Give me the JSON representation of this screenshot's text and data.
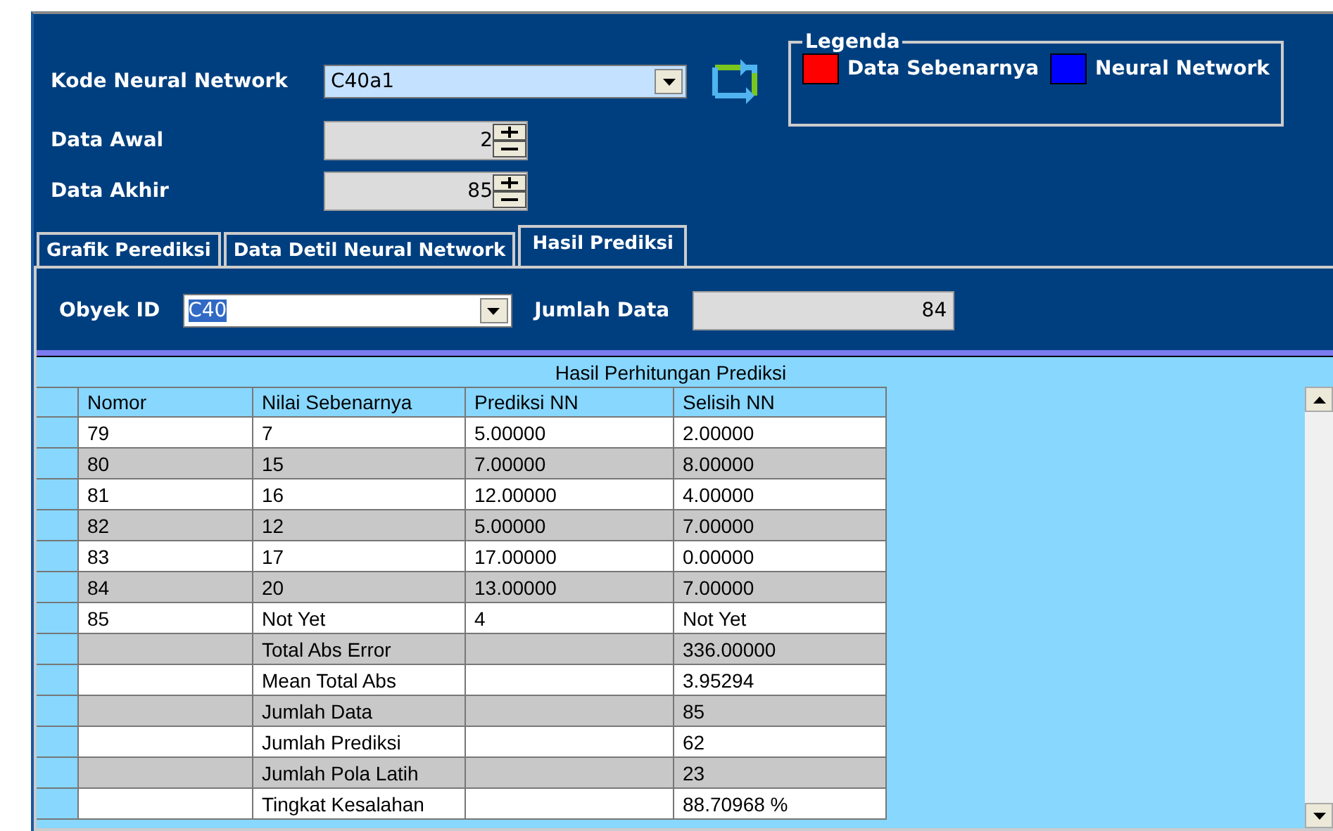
{
  "form": {
    "network_label": "Kode Neural Network",
    "network_value": "C40a1",
    "start_label": "Data Awal",
    "start_value": "2",
    "end_label": "Data Akhir",
    "end_value": "85"
  },
  "legend": {
    "title": "Legenda",
    "items": [
      {
        "label": "Data Sebenarnya",
        "color": "#ff0000"
      },
      {
        "label": "Neural Network",
        "color": "#0000ff"
      }
    ]
  },
  "tabs": [
    {
      "label": "Grafik Perediksi",
      "selected": false
    },
    {
      "label": "Data Detil Neural Network",
      "selected": false
    },
    {
      "label": "Hasil Prediksi",
      "selected": true
    }
  ],
  "filter": {
    "object_label": "Obyek ID",
    "object_value": "C40",
    "count_label": "Jumlah Data",
    "count_value": "84"
  },
  "table": {
    "title": "Hasil Perhitungan Prediksi",
    "columns": [
      "Nomor",
      "Nilai Sebenarnya",
      "Prediksi NN",
      "Selisih NN"
    ],
    "rows": [
      [
        "79",
        "7",
        "5.00000",
        "2.00000"
      ],
      [
        "80",
        "15",
        "7.00000",
        "8.00000"
      ],
      [
        "81",
        "16",
        "12.00000",
        "4.00000"
      ],
      [
        "82",
        "12",
        "5.00000",
        "7.00000"
      ],
      [
        "83",
        "17",
        "17.00000",
        "0.00000"
      ],
      [
        "84",
        "20",
        "13.00000",
        "7.00000"
      ],
      [
        "85",
        "Not Yet",
        "4",
        "Not Yet"
      ],
      [
        "",
        "Total Abs Error",
        "",
        "336.00000"
      ],
      [
        "",
        "Mean Total Abs",
        "",
        "3.95294"
      ],
      [
        "",
        "Jumlah Data",
        "",
        "85"
      ],
      [
        "",
        "Jumlah Prediksi",
        "",
        "62"
      ],
      [
        "",
        "Jumlah Pola Latih",
        "",
        "23"
      ],
      [
        "",
        "Tingkat Kesalahan",
        "",
        "88.70968 %"
      ]
    ]
  }
}
